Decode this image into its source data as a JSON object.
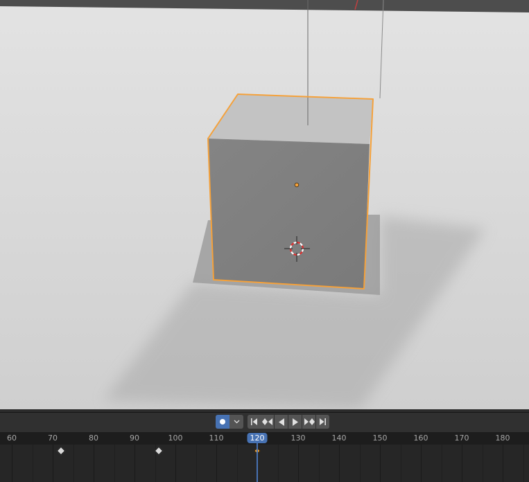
{
  "viewport": {
    "object_name": "cube",
    "selected": true,
    "outline_color": "#f5a13a"
  },
  "timeline": {
    "current_frame": "120",
    "ruler_ticks": [
      "60",
      "70",
      "80",
      "90",
      "100",
      "110",
      "120",
      "130",
      "140",
      "150",
      "160",
      "170",
      "180"
    ],
    "tick_frames": [
      60,
      70,
      80,
      90,
      100,
      110,
      120,
      130,
      140,
      150,
      160,
      170,
      180
    ],
    "keyframes": [
      72,
      96,
      120
    ],
    "active_keyframe": 120,
    "frame_range_visible": [
      57,
      187
    ],
    "accent_color": "#4772b3",
    "controls": {
      "auto_keying": "record-icon",
      "keying_menu": "chevron-down-icon",
      "jump_start": "jump-to-start-icon",
      "prev_keyframe": "prev-keyframe-icon",
      "play_reverse": "play-reverse-icon",
      "play": "play-icon",
      "next_keyframe": "next-keyframe-icon",
      "jump_end": "jump-to-end-icon"
    }
  }
}
